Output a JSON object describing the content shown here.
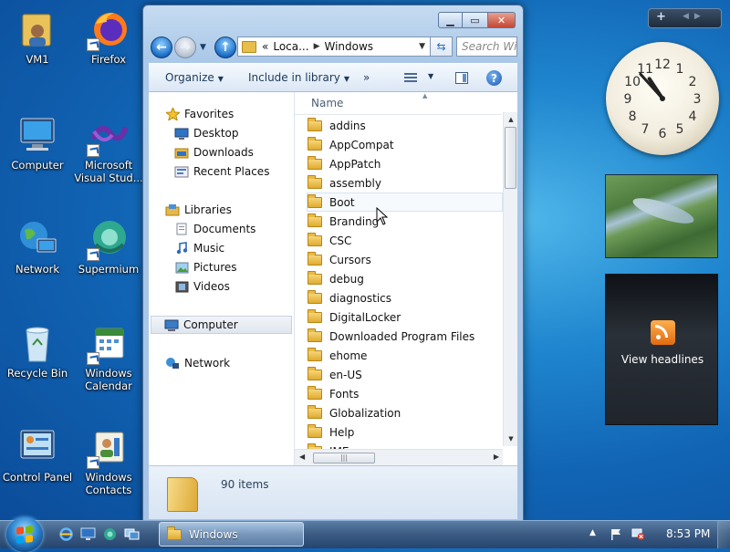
{
  "desktop": {
    "icons": [
      {
        "label": "VM1"
      },
      {
        "label": "Firefox"
      },
      {
        "label": "Computer"
      },
      {
        "label": "Microsoft Visual Stud..."
      },
      {
        "label": "Network"
      },
      {
        "label": "Supermium"
      },
      {
        "label": "Recycle Bin"
      },
      {
        "label": "Windows Calendar"
      },
      {
        "label": "Control Panel"
      },
      {
        "label": "Windows Contacts"
      }
    ]
  },
  "explorer": {
    "address": {
      "crumb_prefix": "«",
      "crumb_1": "Loca...",
      "crumb_2": "Windows"
    },
    "search_placeholder": "Search Win",
    "toolbar": {
      "organize": "Organize",
      "include": "Include in library",
      "more": "»"
    },
    "nav": {
      "favorites": "Favorites",
      "desktop": "Desktop",
      "downloads": "Downloads",
      "recent": "Recent Places",
      "libraries": "Libraries",
      "documents": "Documents",
      "music": "Music",
      "pictures": "Pictures",
      "videos": "Videos",
      "computer": "Computer",
      "network": "Network"
    },
    "column_header": "Name",
    "files": [
      "addins",
      "AppCompat",
      "AppPatch",
      "assembly",
      "Boot",
      "Branding",
      "CSC",
      "Cursors",
      "debug",
      "diagnostics",
      "DigitalLocker",
      "Downloaded Program Files",
      "ehome",
      "en-US",
      "Fonts",
      "Globalization",
      "Help",
      "IME"
    ],
    "status": "90 items"
  },
  "gadgets": {
    "feed_label": "View headlines",
    "clock": {
      "hour": 10,
      "minute": 53
    }
  },
  "taskbar": {
    "window_button": "Windows",
    "time": "8:53 PM"
  },
  "colors": {
    "accent": "#1164b4",
    "folder": "#e0ac2e",
    "close": "#c44734"
  }
}
